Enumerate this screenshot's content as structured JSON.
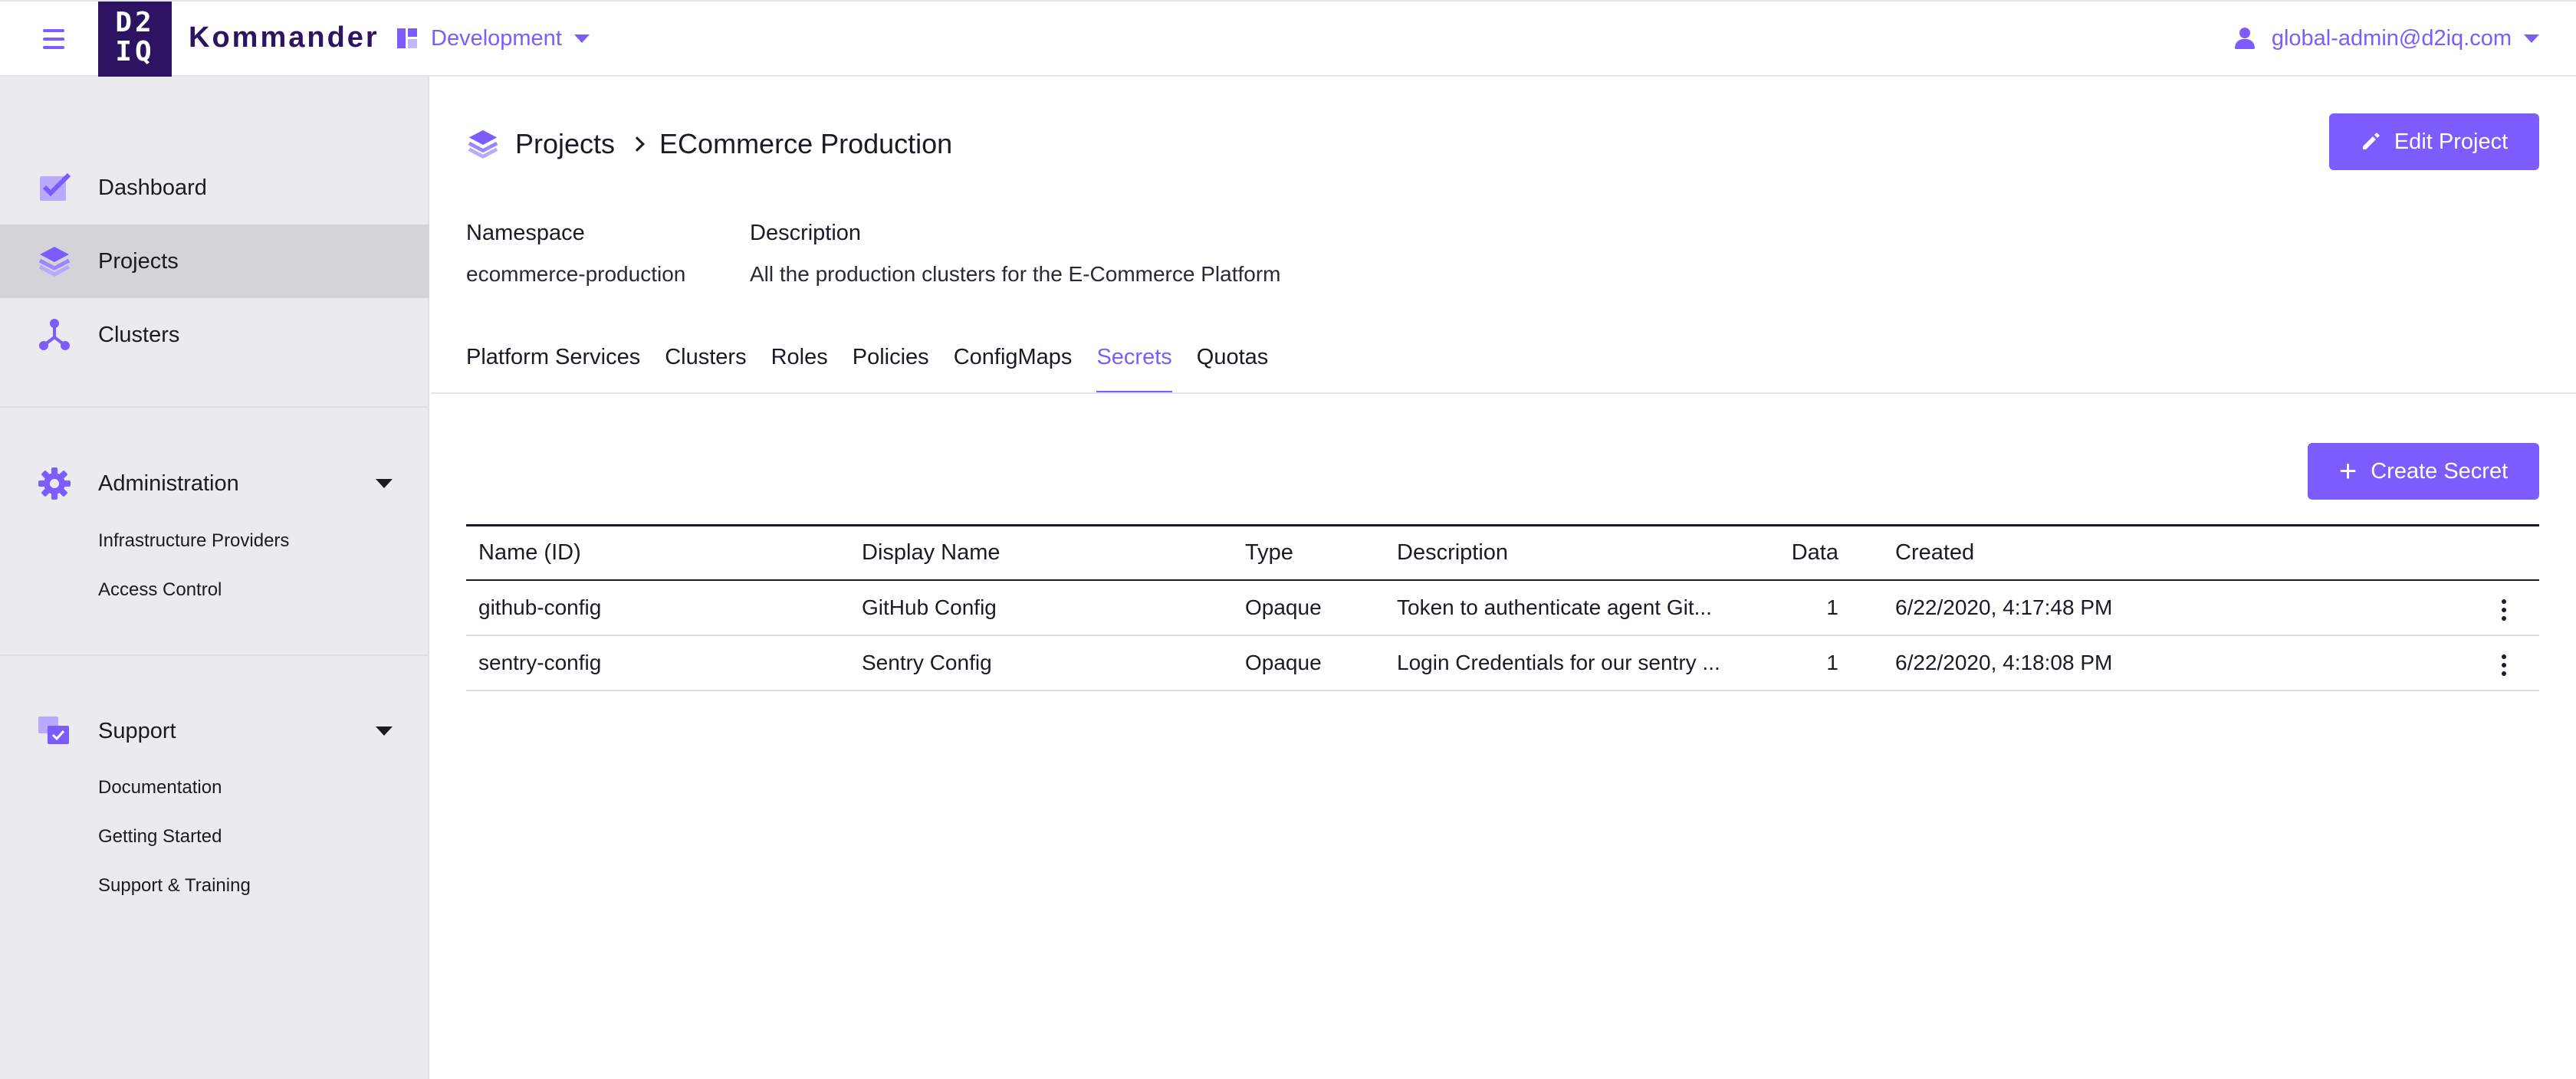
{
  "header": {
    "logo_line1": "D2",
    "logo_line2": "IQ",
    "brand": "Kommander",
    "environment": "Development",
    "user": "global-admin@d2iq.com"
  },
  "sidebar": {
    "items": [
      {
        "label": "Dashboard",
        "icon": "dashboard-icon"
      },
      {
        "label": "Projects",
        "icon": "projects-icon",
        "active": true
      },
      {
        "label": "Clusters",
        "icon": "clusters-icon"
      }
    ],
    "administration": {
      "label": "Administration",
      "icon": "gear-icon",
      "items": [
        "Infrastructure Providers",
        "Access Control"
      ]
    },
    "support": {
      "label": "Support",
      "icon": "support-icon",
      "items": [
        "Documentation",
        "Getting Started",
        "Support & Training"
      ]
    }
  },
  "breadcrumb": {
    "parent": "Projects",
    "current": "ECommerce Production"
  },
  "edit_button": "Edit Project",
  "meta": {
    "namespace_label": "Namespace",
    "namespace_value": "ecommerce-production",
    "description_label": "Description",
    "description_value": "All the production clusters for the E-Commerce Platform"
  },
  "tabs": [
    "Platform Services",
    "Clusters",
    "Roles",
    "Policies",
    "ConfigMaps",
    "Secrets",
    "Quotas"
  ],
  "active_tab": "Secrets",
  "create_button": "Create Secret",
  "table": {
    "columns": [
      "Name (ID)",
      "Display Name",
      "Type",
      "Description",
      "Data",
      "Created"
    ],
    "rows": [
      [
        "github-config",
        "GitHub Config",
        "Opaque",
        "Token to authenticate agent Git...",
        "1",
        "6/22/2020, 4:17:48 PM"
      ],
      [
        "sentry-config",
        "Sentry Config",
        "Opaque",
        "Login Credentials for our sentry ...",
        "1",
        "6/22/2020, 4:18:08 PM"
      ]
    ]
  },
  "colors": {
    "accent": "#7c5cff",
    "logo_bg": "#2c1463",
    "sidebar_bg": "#ebebef",
    "sidebar_active": "#d3d3d9"
  }
}
